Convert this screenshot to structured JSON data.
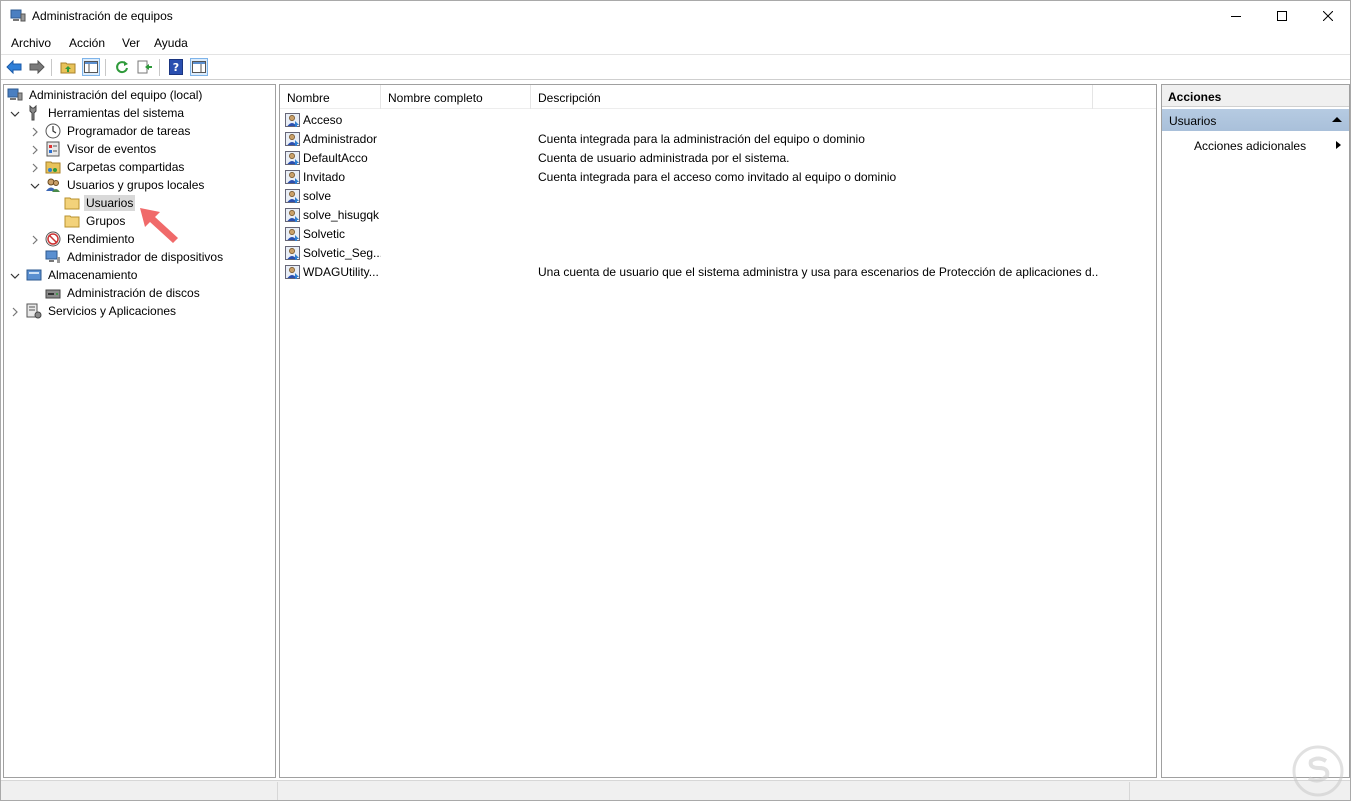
{
  "window": {
    "title": "Administración de equipos"
  },
  "menu": [
    "Archivo",
    "Acción",
    "Ver",
    "Ayuda"
  ],
  "toolbar": {
    "buttons": [
      "back",
      "forward",
      "up-folder",
      "show-hide-tree",
      "refresh",
      "export-list",
      "help",
      "show-hide-action-pane"
    ]
  },
  "tree": {
    "root": "Administración del equipo (local)",
    "items": [
      {
        "label": "Herramientas del sistema",
        "icon": "tools-icon"
      },
      {
        "label": "Programador de tareas",
        "icon": "clock-icon"
      },
      {
        "label": "Visor de eventos",
        "icon": "event-viewer-icon"
      },
      {
        "label": "Carpetas compartidas",
        "icon": "shared-folder-icon"
      },
      {
        "label": "Usuarios y grupos locales",
        "icon": "users-groups-icon"
      },
      {
        "label": "Usuarios",
        "icon": "folder-icon"
      },
      {
        "label": "Grupos",
        "icon": "folder-icon"
      },
      {
        "label": "Rendimiento",
        "icon": "performance-icon"
      },
      {
        "label": "Administrador de dispositivos",
        "icon": "device-manager-icon"
      },
      {
        "label": "Almacenamiento",
        "icon": "storage-icon"
      },
      {
        "label": "Administración de discos",
        "icon": "disk-icon"
      },
      {
        "label": "Servicios y Aplicaciones",
        "icon": "services-icon"
      }
    ]
  },
  "list": {
    "columns": [
      "Nombre",
      "Nombre completo",
      "Descripción"
    ],
    "rows": [
      {
        "name": "Acceso",
        "fullname": "",
        "description": ""
      },
      {
        "name": "Administrador",
        "fullname": "",
        "description": "Cuenta integrada para la administración del equipo o dominio"
      },
      {
        "name": "DefaultAcco",
        "fullname": "",
        "description": "Cuenta de usuario administrada por el sistema."
      },
      {
        "name": "Invitado",
        "fullname": "",
        "description": "Cuenta integrada para el acceso como invitado al equipo o dominio"
      },
      {
        "name": "solve",
        "fullname": "",
        "description": ""
      },
      {
        "name": "solve_hisugqk",
        "fullname": "",
        "description": ""
      },
      {
        "name": "Solvetic",
        "fullname": "",
        "description": ""
      },
      {
        "name": "Solvetic_Seg...",
        "fullname": "",
        "description": ""
      },
      {
        "name": "WDAGUtility...",
        "fullname": "",
        "description": "Una cuenta de usuario que el sistema administra y usa para escenarios de Protección de aplicaciones d..."
      }
    ]
  },
  "actions": {
    "header": "Acciones",
    "section": "Usuarios",
    "item": "Acciones adicionales"
  },
  "colors": {
    "selection": "#d9d9d9",
    "section_bg": "#b6cbe2",
    "annotation_arrow": "#f06a6a"
  }
}
